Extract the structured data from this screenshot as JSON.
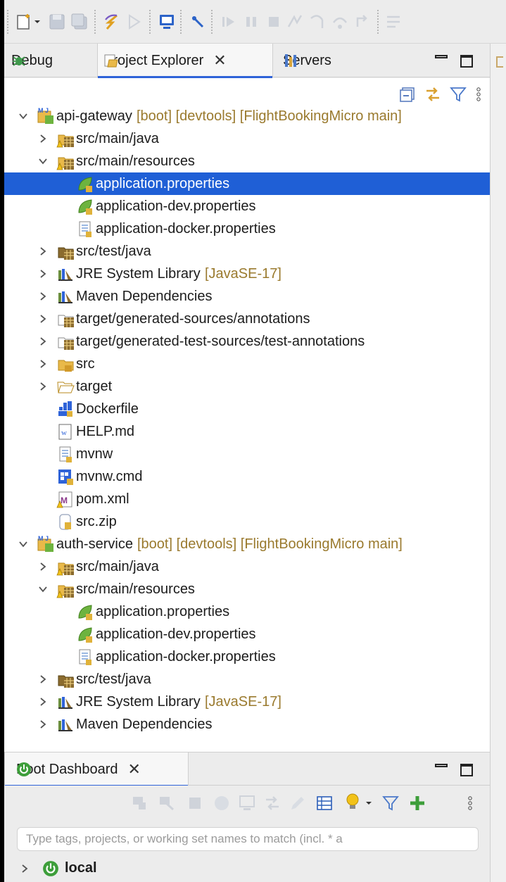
{
  "view_tabs": [
    {
      "label": "Debug"
    },
    {
      "label": "Project Explorer"
    },
    {
      "label": "Servers"
    }
  ],
  "tree": [
    {
      "label": "api-gateway",
      "decor": "[boot] [devtools] [FlightBookingMicro main]",
      "indent": 0,
      "chevron": "down",
      "icon": "boot-project-icon"
    },
    {
      "label": "src/main/java",
      "decor": "",
      "indent": 1,
      "chevron": "right",
      "icon": "source-folder-icon"
    },
    {
      "label": "src/main/resources",
      "decor": "",
      "indent": 1,
      "chevron": "down",
      "icon": "source-folder-icon"
    },
    {
      "label": "application.properties",
      "decor": "",
      "indent": 2,
      "chevron": "",
      "icon": "spring-properties-icon",
      "selected": true
    },
    {
      "label": "application-dev.properties",
      "decor": "",
      "indent": 2,
      "chevron": "",
      "icon": "spring-properties-icon"
    },
    {
      "label": "application-docker.properties",
      "decor": "",
      "indent": 2,
      "chevron": "",
      "icon": "text-file-icon"
    },
    {
      "label": "src/test/java",
      "decor": "",
      "indent": 1,
      "chevron": "right",
      "icon": "test-folder-icon"
    },
    {
      "label": "JRE System Library",
      "decor": "[JavaSE-17]",
      "indent": 1,
      "chevron": "right",
      "icon": "library-icon"
    },
    {
      "label": "Maven Dependencies",
      "decor": "",
      "indent": 1,
      "chevron": "right",
      "icon": "library-icon"
    },
    {
      "label": "target/generated-sources/annotations",
      "decor": "",
      "indent": 1,
      "chevron": "right",
      "icon": "generated-folder-icon"
    },
    {
      "label": "target/generated-test-sources/test-annotations",
      "decor": "",
      "indent": 1,
      "chevron": "right",
      "icon": "generated-folder-icon"
    },
    {
      "label": "src",
      "decor": "",
      "indent": 1,
      "chevron": "right",
      "icon": "folder-icon"
    },
    {
      "label": "target",
      "decor": "",
      "indent": 1,
      "chevron": "right",
      "icon": "open-folder-icon"
    },
    {
      "label": "Dockerfile",
      "decor": "",
      "indent": 1,
      "chevron": "",
      "icon": "docker-file-icon"
    },
    {
      "label": "HELP.md",
      "decor": "",
      "indent": 1,
      "chevron": "",
      "icon": "markdown-file-icon"
    },
    {
      "label": "mvnw",
      "decor": "",
      "indent": 1,
      "chevron": "",
      "icon": "text-file-icon"
    },
    {
      "label": "mvnw.cmd",
      "decor": "",
      "indent": 1,
      "chevron": "",
      "icon": "cmd-file-icon"
    },
    {
      "label": "pom.xml",
      "decor": "",
      "indent": 1,
      "chevron": "",
      "icon": "maven-pom-icon"
    },
    {
      "label": "src.zip",
      "decor": "",
      "indent": 1,
      "chevron": "",
      "icon": "archive-file-icon"
    },
    {
      "label": "auth-service",
      "decor": "[boot] [devtools] [FlightBookingMicro main]",
      "indent": 0,
      "chevron": "down",
      "icon": "boot-project-icon"
    },
    {
      "label": "src/main/java",
      "decor": "",
      "indent": 1,
      "chevron": "right",
      "icon": "source-folder-icon"
    },
    {
      "label": "src/main/resources",
      "decor": "",
      "indent": 1,
      "chevron": "down",
      "icon": "source-folder-icon"
    },
    {
      "label": "application.properties",
      "decor": "",
      "indent": 2,
      "chevron": "",
      "icon": "spring-properties-icon"
    },
    {
      "label": "application-dev.properties",
      "decor": "",
      "indent": 2,
      "chevron": "",
      "icon": "spring-properties-icon"
    },
    {
      "label": "application-docker.properties",
      "decor": "",
      "indent": 2,
      "chevron": "",
      "icon": "text-file-icon"
    },
    {
      "label": "src/test/java",
      "decor": "",
      "indent": 1,
      "chevron": "right",
      "icon": "test-folder-icon"
    },
    {
      "label": "JRE System Library",
      "decor": "[JavaSE-17]",
      "indent": 1,
      "chevron": "right",
      "icon": "library-icon"
    },
    {
      "label": "Maven Dependencies",
      "decor": "",
      "indent": 1,
      "chevron": "right",
      "icon": "library-icon"
    }
  ],
  "boot_dashboard": {
    "tab_label": "Boot Dashboard",
    "filter_placeholder": "Type tags, projects, or working set names to match (incl. * a",
    "nodes": [
      {
        "label": "local"
      }
    ]
  },
  "colors": {
    "selection": "#1f5fd6",
    "decoration": "#9a7a2e",
    "spring_green": "#6db33f",
    "accent_blue": "#2f63d8"
  }
}
